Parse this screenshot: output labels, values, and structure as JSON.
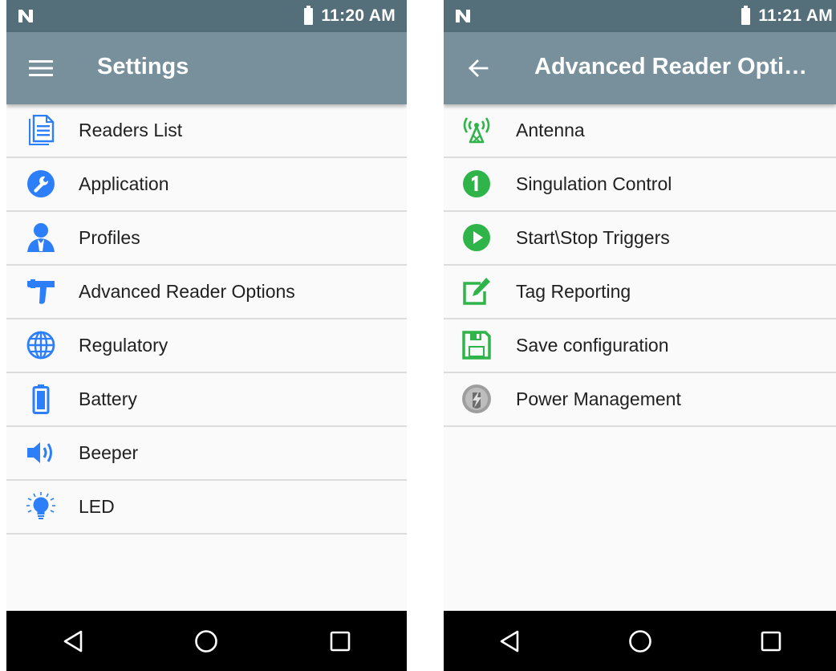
{
  "left_screen": {
    "status": {
      "time": "11:20 AM"
    },
    "appbar": {
      "title": "Settings"
    },
    "menu": [
      {
        "label": "Readers List",
        "icon": "document-icon"
      },
      {
        "label": "Application",
        "icon": "wrench-icon"
      },
      {
        "label": "Profiles",
        "icon": "person-icon"
      },
      {
        "label": "Advanced Reader Options",
        "icon": "rfid-reader-icon"
      },
      {
        "label": "Regulatory",
        "icon": "globe-icon"
      },
      {
        "label": "Battery",
        "icon": "battery-icon"
      },
      {
        "label": "Beeper",
        "icon": "speaker-icon"
      },
      {
        "label": "LED",
        "icon": "lightbulb-icon"
      }
    ]
  },
  "right_screen": {
    "status": {
      "time": "11:21 AM"
    },
    "appbar": {
      "title": "Advanced Reader Opti…"
    },
    "menu": [
      {
        "label": "Antenna",
        "icon": "antenna-icon"
      },
      {
        "label": "Singulation Control",
        "icon": "number-one-icon"
      },
      {
        "label": "Start\\Stop Triggers",
        "icon": "play-icon"
      },
      {
        "label": "Tag Reporting",
        "icon": "edit-icon"
      },
      {
        "label": "Save configuration",
        "icon": "save-icon"
      },
      {
        "label": "Power Management",
        "icon": "power-management-icon"
      }
    ]
  },
  "colors": {
    "status_bar": "#546e7a",
    "app_bar": "#78909c",
    "blue_icon": "#2d7ff9",
    "green_icon": "#2fb44a",
    "nav_bar": "#000000"
  }
}
